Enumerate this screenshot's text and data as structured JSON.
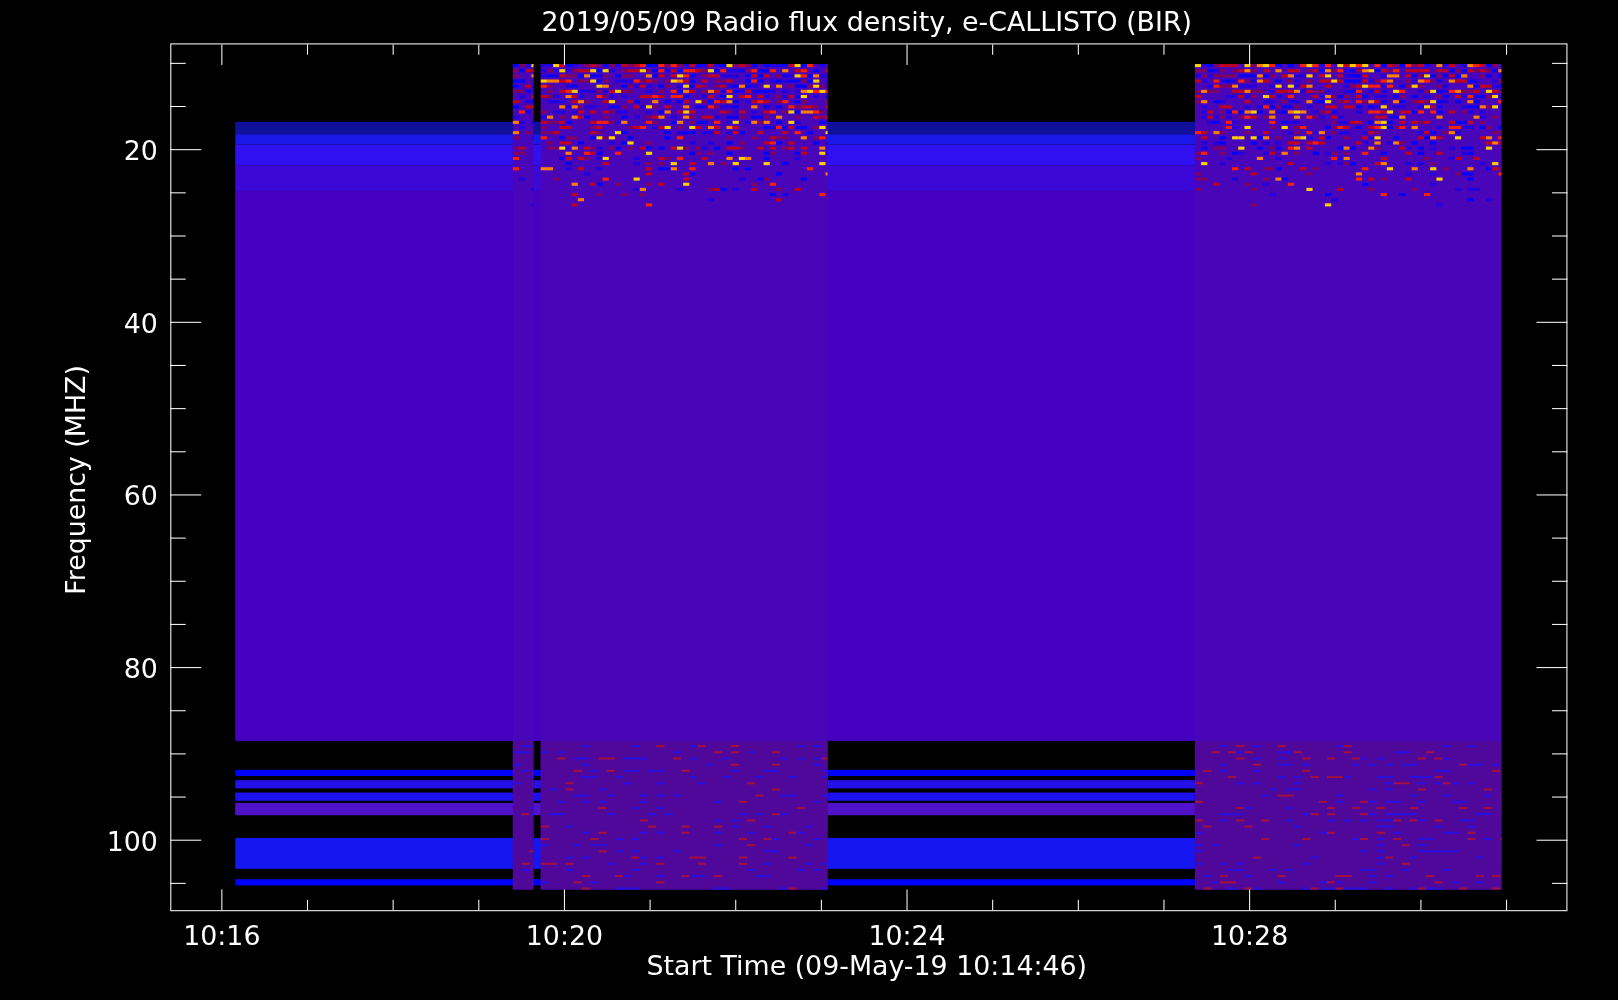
{
  "chart": {
    "title": "2019/05/09  Radio flux density, e-CALLISTO (BIR)",
    "xlabel": "Start Time (09-May-19 10:14:46)",
    "ylabel": "Frequency (MHZ)",
    "xticks": [
      "10:16",
      "10:20",
      "10:24",
      "10:28"
    ],
    "yticks": [
      "20",
      "40",
      "60",
      "80",
      "100"
    ]
  }
}
